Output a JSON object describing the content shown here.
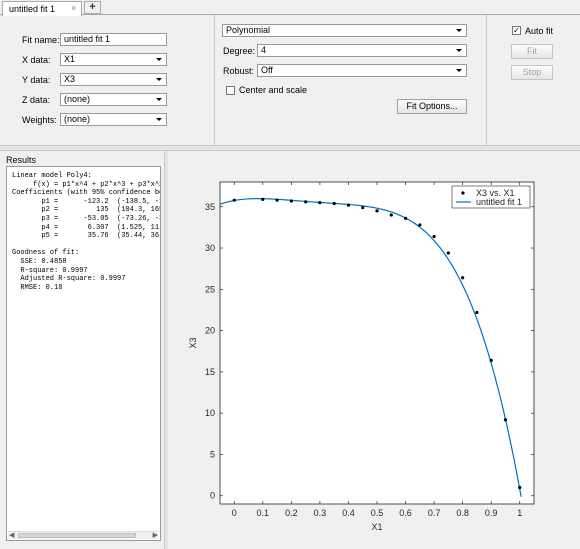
{
  "tab": {
    "label": "untitled fit 1",
    "close": "×",
    "add": "+"
  },
  "form": {
    "fit_name_label": "Fit name:",
    "fit_name_value": "untitled fit 1",
    "x_label": "X data:",
    "x_value": "X1",
    "y_label": "Y data:",
    "y_value": "X3",
    "z_label": "Z data:",
    "z_value": "(none)",
    "w_label": "Weights:",
    "w_value": "(none)"
  },
  "fit": {
    "type": "Polynomial",
    "degree_label": "Degree:",
    "degree_value": "4",
    "robust_label": "Robust:",
    "robust_value": "Off",
    "center_scale_label": "Center and scale",
    "center_scale_checked": false,
    "fit_options_label": "Fit Options..."
  },
  "controls": {
    "auto_fit_label": "Auto fit",
    "auto_fit_checked": true,
    "fit_button": "Fit",
    "stop_button": "Stop"
  },
  "results": {
    "title": "Results",
    "text": "Linear model Poly4:\n     f(x) = p1*x^4 + p2*x^3 + p3*x^2 +\nCoefficients (with 95% confidence boun\n       p1 =      -123.2  (-138.5, -108\n       p2 =         135  (104.3, 165.7\n       p3 =      -53.05  (-73.26, -32.\n       p4 =       6.307  (1.525, 11.09\n       p5 =       35.76  (35.44, 36.09\n\nGoodness of fit:\n  SSE: 0.4858\n  R-square: 0.9997\n  Adjusted R-square: 0.9997\n  RMSE: 0.18"
  },
  "chart_data": {
    "type": "scatter",
    "xlabel": "X1",
    "ylabel": "X3",
    "xlim": [
      -0.05,
      1.05
    ],
    "ylim": [
      -1,
      38
    ],
    "xticks": [
      0,
      0.1,
      0.2,
      0.3,
      0.4,
      0.5,
      0.6,
      0.7,
      0.8,
      0.9,
      1
    ],
    "yticks": [
      0,
      5,
      10,
      15,
      20,
      25,
      30,
      35
    ],
    "grid": false,
    "legend_placement": "top-right",
    "series": [
      {
        "name": "X3 vs. X1",
        "style": "points",
        "color": "#000000",
        "x": [
          0,
          0.1,
          0.15,
          0.2,
          0.25,
          0.3,
          0.35,
          0.4,
          0.45,
          0.5,
          0.55,
          0.6,
          0.65,
          0.7,
          0.75,
          0.8,
          0.85,
          0.9,
          0.95,
          1.0
        ],
        "y": [
          35.8,
          35.9,
          35.8,
          35.7,
          35.6,
          35.5,
          35.4,
          35.2,
          34.9,
          34.5,
          34.0,
          33.6,
          32.8,
          31.4,
          29.4,
          26.4,
          22.2,
          16.4,
          9.2,
          1.0
        ]
      },
      {
        "name": "untitled fit 1",
        "style": "line",
        "color": "#0072bd",
        "coefficients": [
          -123.2,
          135,
          -53.05,
          6.307,
          35.76
        ]
      }
    ]
  }
}
